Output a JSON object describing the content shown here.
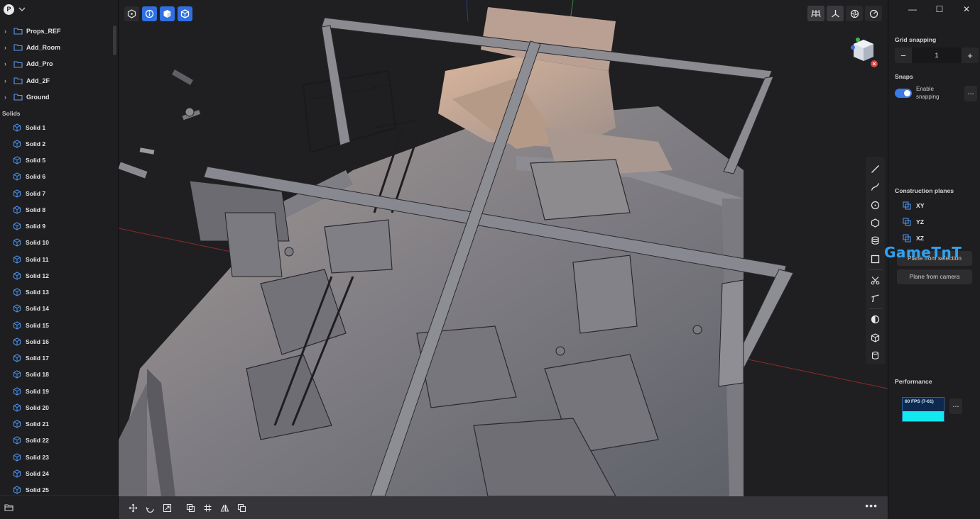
{
  "outliner": {
    "folders": [
      {
        "label": "Props_REF"
      },
      {
        "label": "Add_Room"
      },
      {
        "label": "Add_Pro"
      },
      {
        "label": "Add_2F"
      },
      {
        "label": "Ground"
      }
    ],
    "section_label": "Solids",
    "solids": [
      "Solid 1",
      "Solid 2",
      "Solid 5",
      "Solid 6",
      "Solid 7",
      "Solid 8",
      "Solid 9",
      "Solid 10",
      "Solid 11",
      "Solid 12",
      "Solid 13",
      "Solid 14",
      "Solid 15",
      "Solid 16",
      "Solid 17",
      "Solid 18",
      "Solid 19",
      "Solid 20",
      "Solid 21",
      "Solid 22",
      "Solid 23",
      "Solid 24",
      "Solid 25"
    ]
  },
  "right_panel": {
    "grid_snapping_label": "Grid snapping",
    "grid_value": "1",
    "snaps_label": "Snaps",
    "enable_snapping_label": "Enable snapping",
    "more_label": "...",
    "construction_planes_label": "Construction planes",
    "planes": [
      "XY",
      "YZ",
      "XZ"
    ],
    "plane_from_selection": "Plane from selection",
    "plane_from_camera": "Plane from camera",
    "performance_label": "Performance",
    "fps_text": "60 FPS (7-61)",
    "window_controls": [
      "—",
      "☐",
      "✕"
    ]
  },
  "watermark": "GameTnT",
  "colors": {
    "accent": "#2f6fe0",
    "folder_icon": "#5b9bf0",
    "solid_icon": "#4a90e8",
    "axis_x": "#b83a3a",
    "axis_y": "#3aa34a",
    "perf_bar": "#12e8f0"
  }
}
